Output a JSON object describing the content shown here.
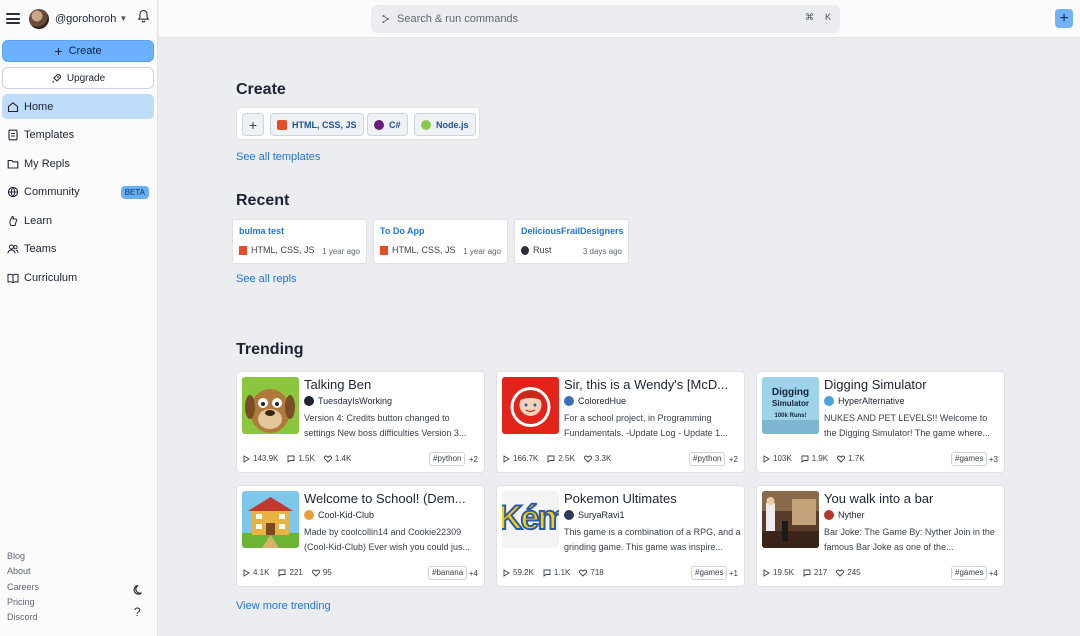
{
  "user": {
    "handle": "@gorohoroh"
  },
  "sidebar": {
    "create_label": "Create",
    "upgrade_label": "Upgrade",
    "items": [
      {
        "label": "Home",
        "icon": "home-icon",
        "active": true
      },
      {
        "label": "Templates",
        "icon": "templates-icon"
      },
      {
        "label": "My Repls",
        "icon": "folder-icon"
      },
      {
        "label": "Community",
        "icon": "globe-icon",
        "badge": "BETA"
      },
      {
        "label": "Learn",
        "icon": "learn-icon"
      },
      {
        "label": "Teams",
        "icon": "teams-icon"
      },
      {
        "label": "Curriculum",
        "icon": "book-icon"
      }
    ],
    "footer": [
      "Blog",
      "About",
      "Careers",
      "Pricing",
      "Discord"
    ],
    "help": "?"
  },
  "search": {
    "placeholder": "Search & run commands",
    "kbd1": "⌘",
    "kbd2": "K"
  },
  "create": {
    "heading": "Create",
    "chips": [
      {
        "label": "HTML, CSS, JS",
        "color": "#e44d26"
      },
      {
        "label": "C#",
        "color": "#68217a"
      },
      {
        "label": "Node.js",
        "color": "#8cc84b"
      }
    ],
    "see_all": "See all templates"
  },
  "recent": {
    "heading": "Recent",
    "cards": [
      {
        "title": "bulma test",
        "lang": "HTML, CSS, JS",
        "ago": "1 year ago"
      },
      {
        "title": "To Do App",
        "lang": "HTML, CSS, JS",
        "ago": "1 year ago"
      },
      {
        "title": "DeliciousFrailDesigners",
        "lang": "Rust",
        "ago": "3 days ago"
      }
    ],
    "see_all": "See all repls"
  },
  "trending": {
    "heading": "Trending",
    "cards": [
      {
        "title": "Talking Ben",
        "user": "TuesdayIsWorking",
        "desc": "Version 4: Credits button changed to settings New boss difficulties Version 3...",
        "runs": "143.9K",
        "comments": "1.5K",
        "likes": "1.4K",
        "tag": "#python",
        "more": "+2"
      },
      {
        "title": "Sir, this is a Wendy's [McD...",
        "user": "ColoredHue",
        "desc": "For a school project, in Programming Fundamentals. -Update Log - Update 1...",
        "runs": "166.7K",
        "comments": "2.5K",
        "likes": "3.3K",
        "tag": "#python",
        "more": "+2"
      },
      {
        "title": "Digging Simulator",
        "user": "HyperAlternative",
        "desc": "NUKES AND PET LEVELS!! Welcome to the Digging Simulator! The game where...",
        "runs": "103K",
        "comments": "1.9K",
        "likes": "1.7K",
        "tag": "#games",
        "more": "+3",
        "thumb_text1": "Digging",
        "thumb_text2": "Simulator",
        "thumb_text3": "100k Runs!"
      },
      {
        "title": "Welcome to School! (Dem...",
        "user": "Cool-Kid-Club",
        "desc": "Made by coolcollin14 and Cookie22309 (Cool-Kid-Club) Ever wish you could jus...",
        "runs": "4.1K",
        "comments": "221",
        "likes": "95",
        "tag": "#banana",
        "more": "+4"
      },
      {
        "title": "Pokemon Ultimates",
        "user": "SuryaRavi1",
        "desc": "This game is a combination of a RPG, and a grinding game. This game was inspire...",
        "runs": "59.2K",
        "comments": "1.1K",
        "likes": "718",
        "tag": "#games",
        "more": "+1",
        "thumb_text1": "Kém"
      },
      {
        "title": "You walk into a bar",
        "user": "Nyther",
        "desc": "Bar Joke: The Game By: Nyther Join in the famous Bar Joke as one of the...",
        "runs": "19.5K",
        "comments": "217",
        "likes": "245",
        "tag": "#games",
        "more": "+4"
      }
    ],
    "view_more": "View more trending"
  }
}
